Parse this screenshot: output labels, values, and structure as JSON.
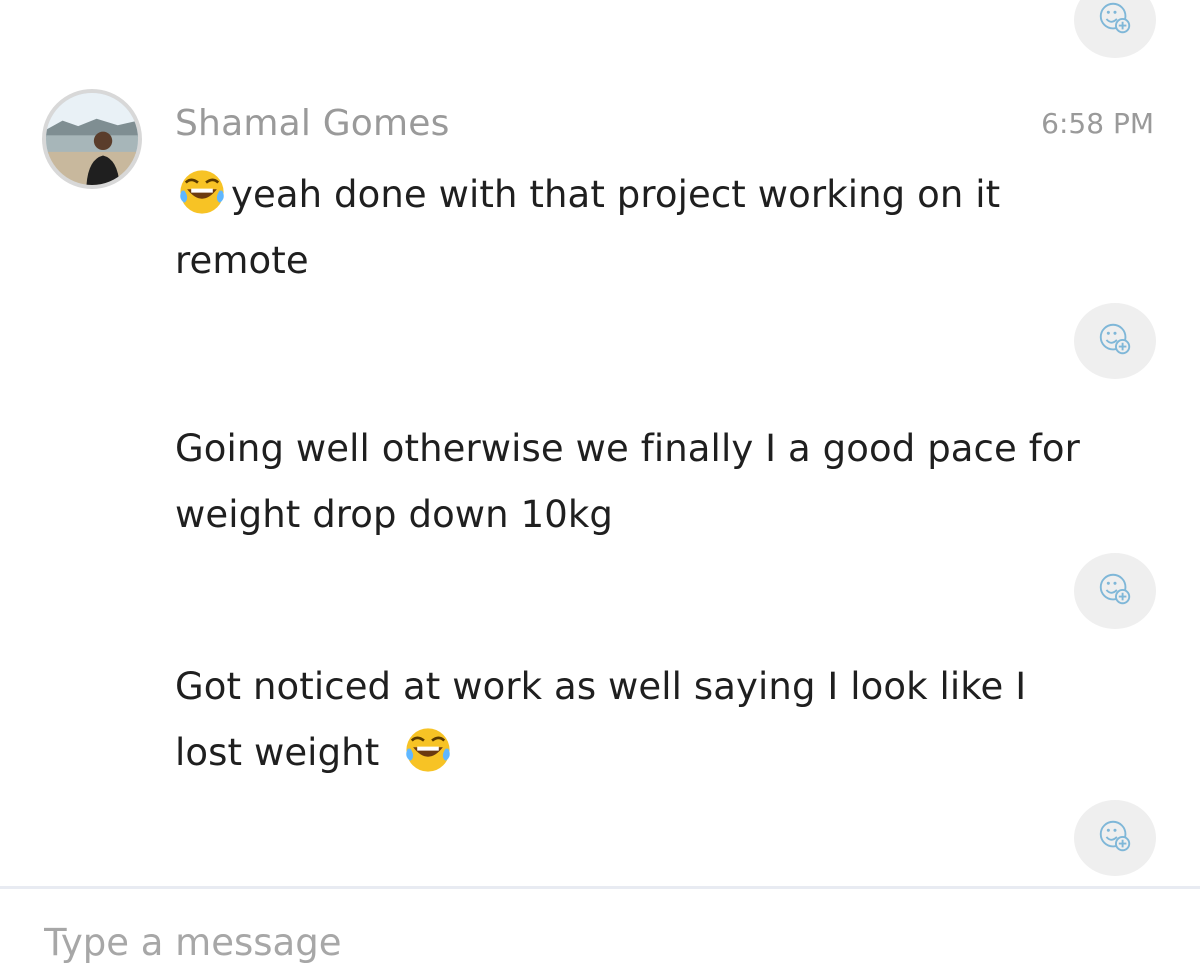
{
  "sender": {
    "name": "Shamal Gomes",
    "timestamp": "6:58 PM"
  },
  "messages": [
    {
      "leading_emoji": "tears-of-joy-emoji",
      "text_line1": "yeah done with that project working on it",
      "text_line2": "remote"
    },
    {
      "text_line1": "Going well otherwise we finally I a good pace for",
      "text_line2": "weight drop down 10kg"
    },
    {
      "text_line1": "Got noticed at work as well saying I look like I",
      "text_line2": "lost weight",
      "trailing_emoji": "tears-of-joy-emoji"
    }
  ],
  "composer": {
    "placeholder": "Type a message"
  },
  "icons": {
    "reaction": "add-reaction-icon",
    "emoji": "tears-of-joy-emoji"
  },
  "colors": {
    "reaction_bg": "#efefef",
    "reaction_icon": "#7fb7d8",
    "name_gray": "#9a9a9a",
    "text_dark": "#1f1f1f"
  }
}
